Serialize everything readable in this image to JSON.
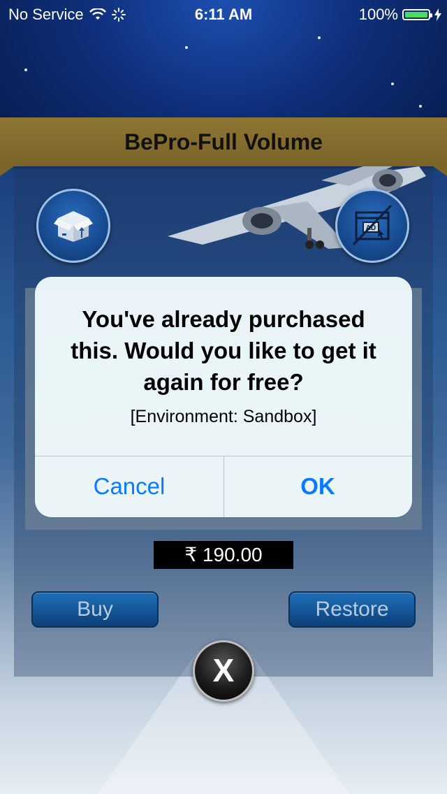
{
  "status_bar": {
    "carrier": "No Service",
    "time": "6:11 AM",
    "battery": "100%",
    "battery_color": "#4cd964"
  },
  "header": {
    "title": "BePro-Full Volume",
    "banner_color": "#7a6428"
  },
  "panel": {
    "left_icon": "box-upload-icon",
    "right_icon": "no-ads-icon",
    "price": "₹ 190.00",
    "buy_label": "Buy",
    "restore_label": "Restore",
    "close_label": "X"
  },
  "alert": {
    "title": "You've already purchased this. Would you like to get it again for free?",
    "message": "[Environment: Sandbox]",
    "cancel_label": "Cancel",
    "ok_label": "OK",
    "button_color": "#0a7aff"
  }
}
